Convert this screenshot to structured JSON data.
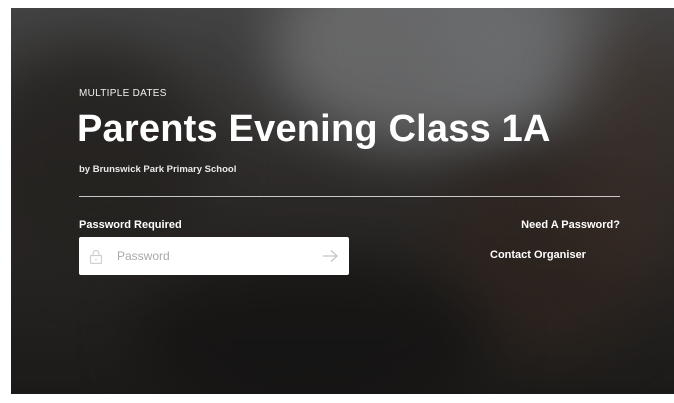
{
  "event": {
    "dates_label": "MULTIPLE DATES",
    "title": "Parents Evening Class 1A",
    "organiser": "by Brunswick Park Primary School"
  },
  "password_form": {
    "label": "Password Required",
    "placeholder": "Password",
    "value": "",
    "lock_icon": "lock-icon",
    "submit_icon": "arrow-right-icon"
  },
  "help": {
    "question": "Need A Password?",
    "contact_link": "Contact Organiser"
  },
  "colors": {
    "text": "#ffffff",
    "input_background": "#ffffff",
    "placeholder": "#a9a9a9"
  }
}
